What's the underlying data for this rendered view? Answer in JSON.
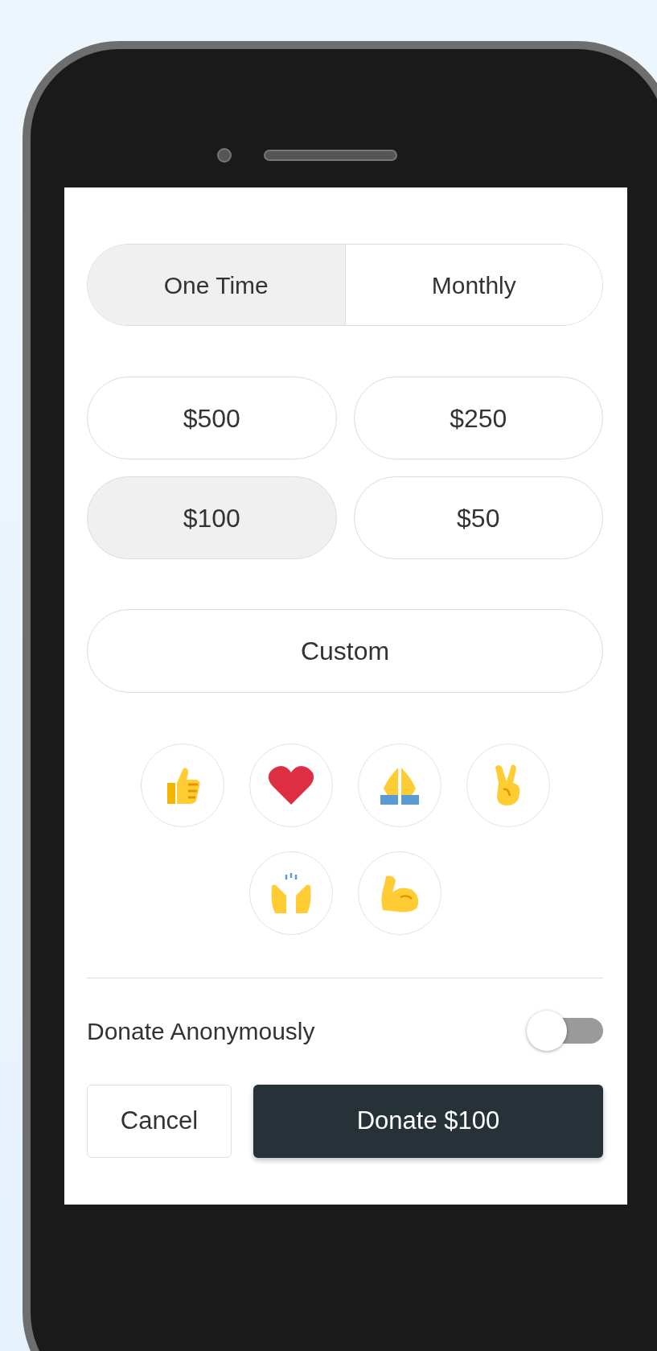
{
  "frequency_tabs": [
    {
      "label": "One Time",
      "selected": true
    },
    {
      "label": "Monthly",
      "selected": false
    }
  ],
  "amounts": [
    {
      "label": "$500",
      "selected": false
    },
    {
      "label": "$250",
      "selected": false
    },
    {
      "label": "$100",
      "selected": true
    },
    {
      "label": "$50",
      "selected": false
    }
  ],
  "custom_amount": {
    "label": "Custom",
    "selected": false
  },
  "anonymous": {
    "label": "Donate Anonymously",
    "on": false
  },
  "buttons": {
    "cancel": "Cancel",
    "donate": "Donate $100"
  }
}
